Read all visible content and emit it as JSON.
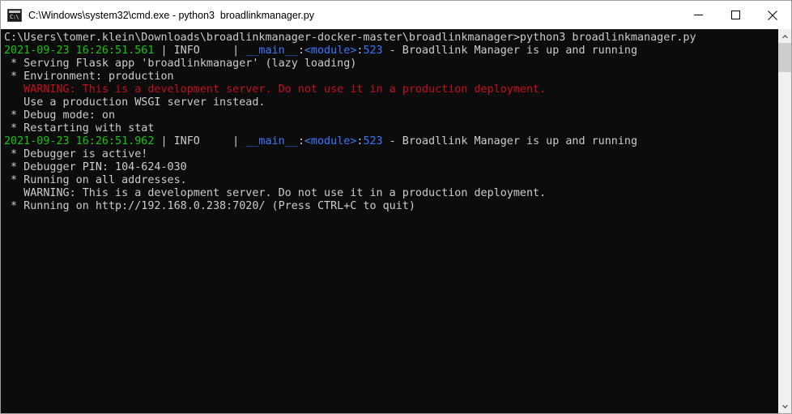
{
  "window": {
    "title": "C:\\Windows\\system32\\cmd.exe - python3  broadlinkmanager.py",
    "icon": "cmd-console-icon",
    "icon_prompt_text": "C:\\",
    "controls": {
      "minimize_label": "Minimize",
      "maximize_label": "Maximize",
      "close_label": "Close"
    }
  },
  "scrollbar": {
    "up_arrow_label": "scroll-up",
    "down_arrow_label": "scroll-down",
    "thumb_label": "scroll-thumb"
  },
  "console": {
    "background_color": "#0c0c0c",
    "colors": {
      "default": "#cccccc",
      "timestamp": "#16c60c",
      "warning": "#c50f1f",
      "logger": "#3b78ff"
    },
    "lines": [
      {
        "id": "prompt-command",
        "segments": [
          {
            "text": "C:\\Users\\tomer.klein\\Downloads\\broadlinkmanager-docker-master\\broadlinkmanager>python3 broadlinkmanager.py",
            "color": "default"
          }
        ]
      },
      {
        "id": "log-info-1",
        "segments": [
          {
            "text": "2021-09-23 16:26:51.561",
            "color": "timestamp"
          },
          {
            "text": " | ",
            "color": "default"
          },
          {
            "text": "INFO",
            "color": "default"
          },
          {
            "text": "     | ",
            "color": "default"
          },
          {
            "text": "__main__",
            "color": "logger"
          },
          {
            "text": ":",
            "color": "default"
          },
          {
            "text": "<module>",
            "color": "logger"
          },
          {
            "text": ":",
            "color": "default"
          },
          {
            "text": "523",
            "color": "logger"
          },
          {
            "text": " - Broadllink Manager is up and running",
            "color": "default"
          }
        ]
      },
      {
        "id": "serving-flask-app",
        "segments": [
          {
            "text": " * Serving Flask app 'broadlinkmanager' (lazy loading)",
            "color": "default"
          }
        ]
      },
      {
        "id": "environment",
        "segments": [
          {
            "text": " * Environment: production",
            "color": "default"
          }
        ]
      },
      {
        "id": "warning-dev-server-1",
        "segments": [
          {
            "text": "   WARNING: This is a development server. Do not use it in a production deployment.",
            "color": "warning"
          }
        ]
      },
      {
        "id": "use-wsgi-server",
        "segments": [
          {
            "text": "   Use a production WSGI server instead.",
            "color": "default"
          }
        ]
      },
      {
        "id": "debug-mode",
        "segments": [
          {
            "text": " * Debug mode: on",
            "color": "default"
          }
        ]
      },
      {
        "id": "restarting-with-stat",
        "segments": [
          {
            "text": " * Restarting with stat",
            "color": "default"
          }
        ]
      },
      {
        "id": "log-info-2",
        "segments": [
          {
            "text": "2021-09-23 16:26:51.962",
            "color": "timestamp"
          },
          {
            "text": " | ",
            "color": "default"
          },
          {
            "text": "INFO",
            "color": "default"
          },
          {
            "text": "     | ",
            "color": "default"
          },
          {
            "text": "__main__",
            "color": "logger"
          },
          {
            "text": ":",
            "color": "default"
          },
          {
            "text": "<module>",
            "color": "logger"
          },
          {
            "text": ":",
            "color": "default"
          },
          {
            "text": "523",
            "color": "logger"
          },
          {
            "text": " - Broadllink Manager is up and running",
            "color": "default"
          }
        ]
      },
      {
        "id": "debugger-active",
        "segments": [
          {
            "text": " * Debugger is active!",
            "color": "default"
          }
        ]
      },
      {
        "id": "debugger-pin",
        "segments": [
          {
            "text": " * Debugger PIN: 104-624-030",
            "color": "default"
          }
        ]
      },
      {
        "id": "running-all-addresses",
        "segments": [
          {
            "text": " * Running on all addresses.",
            "color": "default"
          }
        ]
      },
      {
        "id": "warning-dev-server-2",
        "segments": [
          {
            "text": "   WARNING: This is a development server. Do not use it in a production deployment.",
            "color": "default"
          }
        ]
      },
      {
        "id": "running-on-url",
        "segments": [
          {
            "text": " * Running on http://192.168.0.238:7020/ (Press CTRL+C to quit)",
            "color": "default"
          }
        ]
      }
    ]
  }
}
